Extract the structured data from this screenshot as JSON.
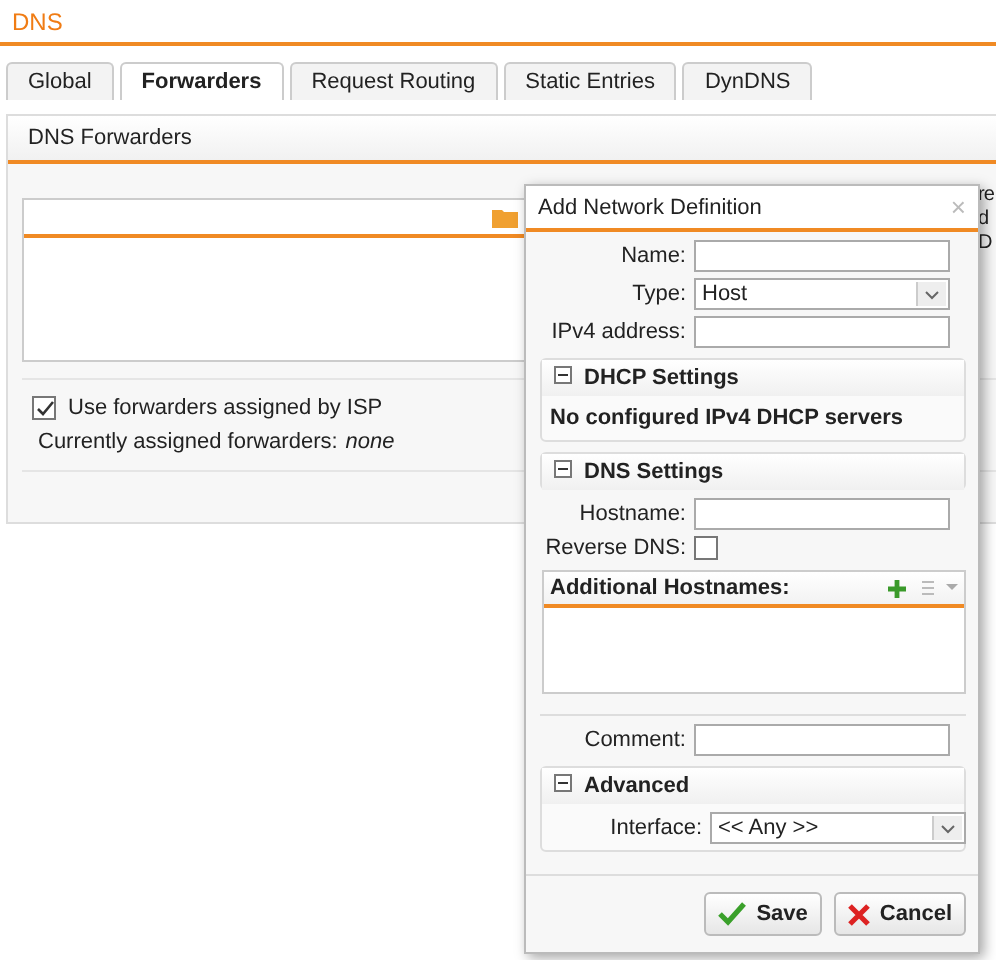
{
  "page_title": "DNS",
  "tabs": [
    {
      "label": "Global",
      "selected": false
    },
    {
      "label": "Forwarders",
      "selected": true
    },
    {
      "label": "Request Routing",
      "selected": false
    },
    {
      "label": "Static Entries",
      "selected": false
    },
    {
      "label": "DynDNS",
      "selected": false
    }
  ],
  "panel": {
    "title": "DNS Forwarders",
    "side_text": [
      "re",
      "d",
      "D"
    ],
    "isp_checkbox": {
      "label": "Use forwarders assigned by ISP",
      "checked": true
    },
    "assigned_label": "Currently assigned forwarders:",
    "assigned_value": "none"
  },
  "dialog": {
    "title": "Add Network Definition",
    "close": "×",
    "name_label": "Name:",
    "type_label": "Type:",
    "type_value": "Host",
    "ipv4_label": "IPv4 address:",
    "dhcp": {
      "title": "DHCP Settings",
      "expanded": true,
      "message": "No configured IPv4 DHCP servers"
    },
    "dns": {
      "title": "DNS Settings",
      "expanded": true,
      "hostname_label": "Hostname:",
      "reverse_label": "Reverse DNS:",
      "reverse_checked": false,
      "additional_title": "Additional Hostnames:"
    },
    "comment_label": "Comment:",
    "advanced": {
      "title": "Advanced",
      "expanded": true,
      "interface_label": "Interface:",
      "interface_value": "<< Any >>"
    },
    "buttons": [
      {
        "kind": "save",
        "label": "Save"
      },
      {
        "kind": "cancel",
        "label": "Cancel"
      }
    ]
  }
}
